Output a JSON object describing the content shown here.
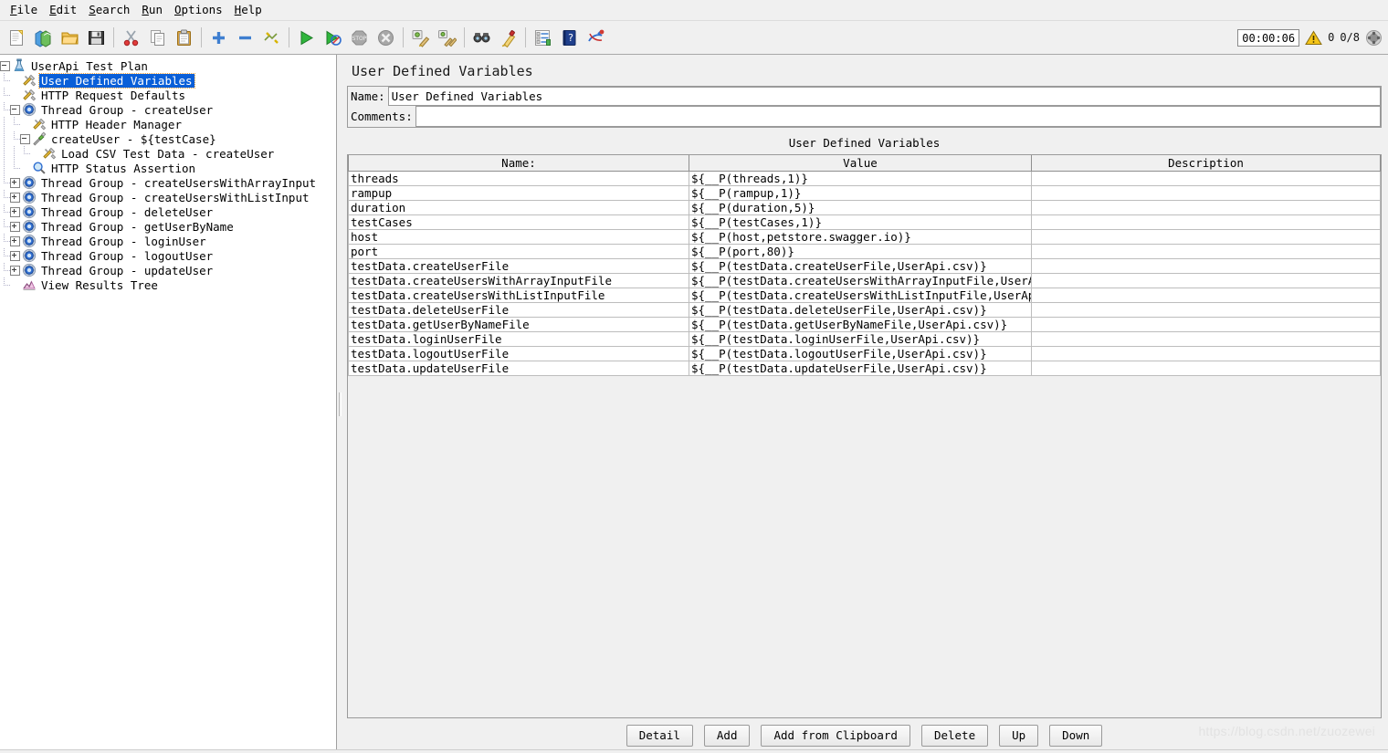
{
  "menubar": {
    "items": [
      {
        "pre": "",
        "mnemonic": "F",
        "post": "ile",
        "name": "menu-file"
      },
      {
        "pre": "",
        "mnemonic": "E",
        "post": "dit",
        "name": "menu-edit"
      },
      {
        "pre": "",
        "mnemonic": "S",
        "post": "earch",
        "name": "menu-search"
      },
      {
        "pre": "",
        "mnemonic": "R",
        "post": "un",
        "name": "menu-run"
      },
      {
        "pre": "",
        "mnemonic": "O",
        "post": "ptions",
        "name": "menu-options"
      },
      {
        "pre": "",
        "mnemonic": "H",
        "post": "elp",
        "name": "menu-help"
      }
    ]
  },
  "toolbar": {
    "buttons": [
      {
        "icon": "new-icon",
        "title": "New"
      },
      {
        "icon": "templates-icon",
        "title": "Templates"
      },
      {
        "icon": "open-icon",
        "title": "Open"
      },
      {
        "icon": "save-icon",
        "title": "Save Test Plan"
      },
      {
        "icon": "cut-icon",
        "title": "Cut"
      },
      {
        "icon": "copy-icon",
        "title": "Copy"
      },
      {
        "icon": "paste-icon",
        "title": "Paste"
      },
      {
        "icon": "expand-all-icon",
        "title": "Expand All"
      },
      {
        "icon": "collapse-all-icon",
        "title": "Collapse All"
      },
      {
        "icon": "toggle-icon",
        "title": "Toggle"
      },
      {
        "icon": "start-icon",
        "title": "Start"
      },
      {
        "icon": "start-no-timers-icon",
        "title": "Start no pauses"
      },
      {
        "icon": "stop-icon",
        "title": "Stop"
      },
      {
        "icon": "shutdown-icon",
        "title": "Shutdown"
      },
      {
        "icon": "clear-icon",
        "title": "Clear"
      },
      {
        "icon": "clear-all-icon",
        "title": "Clear All"
      },
      {
        "icon": "search-icon",
        "title": "Search"
      },
      {
        "icon": "reset-search-icon",
        "title": "Reset Search"
      },
      {
        "icon": "function-helper-icon",
        "title": "Function Helper Dialog"
      },
      {
        "icon": "help-icon",
        "title": "Help"
      },
      {
        "icon": "undo-redo-icon",
        "title": "Undo"
      }
    ],
    "timer": "00:00:06",
    "warning_count": "0",
    "thread_count": "0/8",
    "warning_icon": "warning-triangle-icon",
    "threads_icon": "threads-gauge-icon"
  },
  "tree": {
    "nodes": [
      {
        "label": "UserApi Test Plan",
        "depth": 0,
        "icon": "test-plan-flask-icon",
        "handle": "minus",
        "selected": false
      },
      {
        "label": "User Defined Variables",
        "depth": 1,
        "icon": "config-element-icon",
        "handle": "none",
        "selected": true
      },
      {
        "label": "HTTP Request Defaults",
        "depth": 1,
        "icon": "config-element-icon",
        "handle": "none",
        "selected": false
      },
      {
        "label": "Thread Group - createUser",
        "depth": 1,
        "icon": "thread-group-icon",
        "handle": "minus",
        "selected": false
      },
      {
        "label": "HTTP Header Manager",
        "depth": 2,
        "icon": "config-element-icon",
        "handle": "none",
        "selected": false
      },
      {
        "label": "createUser - ${testCase}",
        "depth": 2,
        "icon": "http-sampler-icon",
        "handle": "minus",
        "selected": false
      },
      {
        "label": "Load CSV Test Data - createUser",
        "depth": 3,
        "icon": "config-element-icon",
        "handle": "none",
        "selected": false
      },
      {
        "label": "HTTP Status Assertion",
        "depth": 2,
        "icon": "assertion-magnifier-icon",
        "handle": "none",
        "selected": false
      },
      {
        "label": "Thread Group - createUsersWithArrayInput",
        "depth": 1,
        "icon": "thread-group-icon",
        "handle": "plus",
        "selected": false
      },
      {
        "label": "Thread Group - createUsersWithListInput",
        "depth": 1,
        "icon": "thread-group-icon",
        "handle": "plus",
        "selected": false
      },
      {
        "label": "Thread Group - deleteUser",
        "depth": 1,
        "icon": "thread-group-icon",
        "handle": "plus",
        "selected": false
      },
      {
        "label": "Thread Group - getUserByName",
        "depth": 1,
        "icon": "thread-group-icon",
        "handle": "plus",
        "selected": false
      },
      {
        "label": "Thread Group - loginUser",
        "depth": 1,
        "icon": "thread-group-icon",
        "handle": "plus",
        "selected": false
      },
      {
        "label": "Thread Group - logoutUser",
        "depth": 1,
        "icon": "thread-group-icon",
        "handle": "plus",
        "selected": false
      },
      {
        "label": "Thread Group - updateUser",
        "depth": 1,
        "icon": "thread-group-icon",
        "handle": "plus",
        "selected": false
      },
      {
        "label": "View Results Tree",
        "depth": 1,
        "icon": "view-results-tree-icon",
        "handle": "none",
        "selected": false
      }
    ]
  },
  "main": {
    "title": "User Defined Variables",
    "name_label": "Name:",
    "name_value": "User Defined Variables",
    "comments_label": "Comments:",
    "comments_value": "",
    "table_caption": "User Defined Variables",
    "columns": [
      "Name:",
      "Value",
      "Description"
    ],
    "rows": [
      {
        "name": "threads",
        "value": "${__P(threads,1)}",
        "description": ""
      },
      {
        "name": "rampup",
        "value": "${__P(rampup,1)}",
        "description": ""
      },
      {
        "name": "duration",
        "value": "${__P(duration,5)}",
        "description": ""
      },
      {
        "name": "testCases",
        "value": "${__P(testCases,1)}",
        "description": ""
      },
      {
        "name": "host",
        "value": "${__P(host,petstore.swagger.io)}",
        "description": ""
      },
      {
        "name": "port",
        "value": "${__P(port,80)}",
        "description": ""
      },
      {
        "name": "testData.createUserFile",
        "value": "${__P(testData.createUserFile,UserApi.csv)}",
        "description": ""
      },
      {
        "name": "testData.createUsersWithArrayInputFile",
        "value": "${__P(testData.createUsersWithArrayInputFile,UserApi.csv)}",
        "description": ""
      },
      {
        "name": "testData.createUsersWithListInputFile",
        "value": "${__P(testData.createUsersWithListInputFile,UserApi.csv)}",
        "description": ""
      },
      {
        "name": "testData.deleteUserFile",
        "value": "${__P(testData.deleteUserFile,UserApi.csv)}",
        "description": ""
      },
      {
        "name": "testData.getUserByNameFile",
        "value": "${__P(testData.getUserByNameFile,UserApi.csv)}",
        "description": ""
      },
      {
        "name": "testData.loginUserFile",
        "value": "${__P(testData.loginUserFile,UserApi.csv)}",
        "description": ""
      },
      {
        "name": "testData.logoutUserFile",
        "value": "${__P(testData.logoutUserFile,UserApi.csv)}",
        "description": ""
      },
      {
        "name": "testData.updateUserFile",
        "value": "${__P(testData.updateUserFile,UserApi.csv)}",
        "description": ""
      }
    ],
    "buttons": [
      {
        "label": "Detail",
        "name": "detail-button"
      },
      {
        "label": "Add",
        "name": "add-button"
      },
      {
        "label": "Add from Clipboard",
        "name": "add-from-clipboard-button"
      },
      {
        "label": "Delete",
        "name": "delete-button"
      },
      {
        "label": "Up",
        "name": "up-button"
      },
      {
        "label": "Down",
        "name": "down-button"
      }
    ]
  },
  "watermark": "https://blog.csdn.net/zuozewei",
  "colors": {
    "selection": "#0a5fd8",
    "panel_bg": "#f0f0f0",
    "tree_bg": "#ffffff",
    "grid_line": "#bdbdbd",
    "warning": "#f2c200"
  }
}
